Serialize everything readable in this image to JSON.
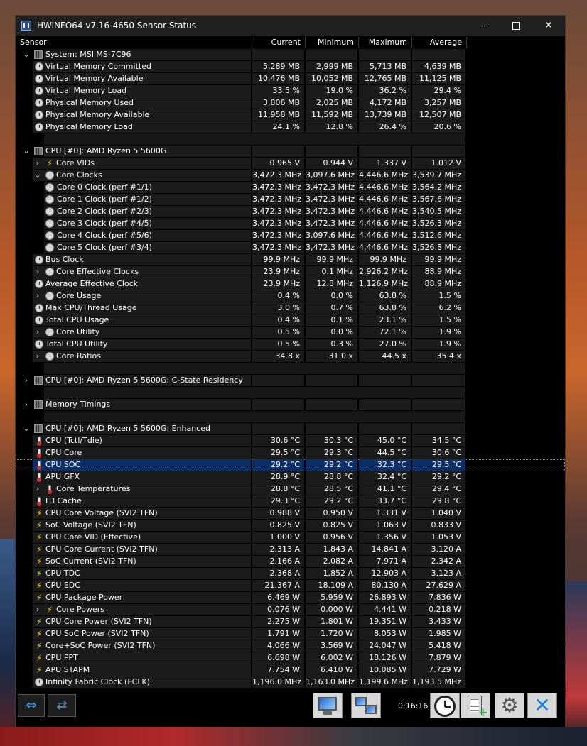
{
  "window": {
    "title": "HWiNFO64 v7.16-4650 Sensor Status"
  },
  "columns": [
    "Sensor",
    "Current",
    "Minimum",
    "Maximum",
    "Average"
  ],
  "rows": [
    {
      "kind": "group",
      "name": "System: MSI MS-7C96",
      "toggle": "v",
      "icon": "chip"
    },
    {
      "kind": "row",
      "name": "Virtual Memory Committed",
      "icon": "clock",
      "level": 0,
      "v": [
        "5,289 MB",
        "2,999 MB",
        "5,713 MB",
        "4,639 MB"
      ]
    },
    {
      "kind": "row",
      "name": "Virtual Memory Available",
      "icon": "clock",
      "level": 0,
      "v": [
        "10,476 MB",
        "10,052 MB",
        "12,765 MB",
        "11,125 MB"
      ]
    },
    {
      "kind": "row",
      "name": "Virtual Memory Load",
      "icon": "clock",
      "level": 0,
      "v": [
        "33.5 %",
        "19.0 %",
        "36.2 %",
        "29.4 %"
      ]
    },
    {
      "kind": "row",
      "name": "Physical Memory Used",
      "icon": "clock",
      "level": 0,
      "v": [
        "3,806 MB",
        "2,025 MB",
        "4,172 MB",
        "3,257 MB"
      ]
    },
    {
      "kind": "row",
      "name": "Physical Memory Available",
      "icon": "clock",
      "level": 0,
      "v": [
        "11,958 MB",
        "11,592 MB",
        "13,739 MB",
        "12,507 MB"
      ]
    },
    {
      "kind": "row",
      "name": "Physical Memory Load",
      "icon": "clock",
      "level": 0,
      "v": [
        "24.1 %",
        "12.8 %",
        "26.4 %",
        "20.6 %"
      ]
    },
    {
      "kind": "blank"
    },
    {
      "kind": "group",
      "name": "CPU [#0]: AMD Ryzen 5 5600G",
      "toggle": "v",
      "icon": "chip"
    },
    {
      "kind": "row",
      "name": "Core VIDs",
      "icon": "bolt",
      "level": 0,
      "toggle": ">",
      "v": [
        "0.965 V",
        "0.944 V",
        "1.337 V",
        "1.012 V"
      ]
    },
    {
      "kind": "row",
      "name": "Core Clocks",
      "icon": "clock",
      "level": 0,
      "toggle": "v",
      "v": [
        "3,472.3 MHz",
        "3,097.6 MHz",
        "4,446.6 MHz",
        "3,539.7 MHz"
      ]
    },
    {
      "kind": "row",
      "name": "Core 0 Clock (perf #1/1)",
      "icon": "clock",
      "level": 1,
      "v": [
        "3,472.3 MHz",
        "3,472.3 MHz",
        "4,446.6 MHz",
        "3,564.2 MHz"
      ]
    },
    {
      "kind": "row",
      "name": "Core 1 Clock (perf #1/2)",
      "icon": "clock",
      "level": 1,
      "v": [
        "3,472.3 MHz",
        "3,472.3 MHz",
        "4,446.6 MHz",
        "3,567.6 MHz"
      ]
    },
    {
      "kind": "row",
      "name": "Core 2 Clock (perf #2/3)",
      "icon": "clock",
      "level": 1,
      "v": [
        "3,472.3 MHz",
        "3,472.3 MHz",
        "4,446.6 MHz",
        "3,540.5 MHz"
      ]
    },
    {
      "kind": "row",
      "name": "Core 3 Clock (perf #4/5)",
      "icon": "clock",
      "level": 1,
      "v": [
        "3,472.3 MHz",
        "3,472.3 MHz",
        "4,446.6 MHz",
        "3,526.3 MHz"
      ]
    },
    {
      "kind": "row",
      "name": "Core 4 Clock (perf #5/6)",
      "icon": "clock",
      "level": 1,
      "v": [
        "3,472.3 MHz",
        "3,097.6 MHz",
        "4,446.6 MHz",
        "3,512.6 MHz"
      ]
    },
    {
      "kind": "row",
      "name": "Core 5 Clock (perf #3/4)",
      "icon": "clock",
      "level": 1,
      "v": [
        "3,472.3 MHz",
        "3,472.3 MHz",
        "4,446.6 MHz",
        "3,526.8 MHz"
      ]
    },
    {
      "kind": "row",
      "name": "Bus Clock",
      "icon": "clock",
      "level": 0,
      "v": [
        "99.9 MHz",
        "99.9 MHz",
        "99.9 MHz",
        "99.9 MHz"
      ]
    },
    {
      "kind": "row",
      "name": "Core Effective Clocks",
      "icon": "clock",
      "level": 0,
      "toggle": ">",
      "v": [
        "23.9 MHz",
        "0.1 MHz",
        "2,926.2 MHz",
        "88.9 MHz"
      ]
    },
    {
      "kind": "row",
      "name": "Average Effective Clock",
      "icon": "clock",
      "level": 0,
      "v": [
        "23.9 MHz",
        "12.8 MHz",
        "1,126.9 MHz",
        "88.9 MHz"
      ]
    },
    {
      "kind": "row",
      "name": "Core Usage",
      "icon": "clock",
      "level": 0,
      "toggle": ">",
      "v": [
        "0.4 %",
        "0.0 %",
        "63.8 %",
        "1.5 %"
      ]
    },
    {
      "kind": "row",
      "name": "Max CPU/Thread Usage",
      "icon": "clock",
      "level": 0,
      "v": [
        "3.0 %",
        "0.7 %",
        "63.8 %",
        "6.2 %"
      ]
    },
    {
      "kind": "row",
      "name": "Total CPU Usage",
      "icon": "clock",
      "level": 0,
      "v": [
        "0.4 %",
        "0.1 %",
        "23.1 %",
        "1.5 %"
      ]
    },
    {
      "kind": "row",
      "name": "Core Utility",
      "icon": "clock",
      "level": 0,
      "toggle": ">",
      "v": [
        "0.5 %",
        "0.0 %",
        "72.1 %",
        "1.9 %"
      ]
    },
    {
      "kind": "row",
      "name": "Total CPU Utility",
      "icon": "clock",
      "level": 0,
      "v": [
        "0.5 %",
        "0.3 %",
        "27.0 %",
        "1.9 %"
      ]
    },
    {
      "kind": "row",
      "name": "Core Ratios",
      "icon": "clock",
      "level": 0,
      "toggle": ">",
      "v": [
        "34.8 x",
        "31.0 x",
        "44.5 x",
        "35.4 x"
      ]
    },
    {
      "kind": "blank"
    },
    {
      "kind": "group",
      "name": "CPU [#0]: AMD Ryzen 5 5600G: C-State Residency",
      "toggle": ">",
      "icon": "chip"
    },
    {
      "kind": "blank"
    },
    {
      "kind": "group",
      "name": "Memory Timings",
      "toggle": ">",
      "icon": "chip"
    },
    {
      "kind": "blank"
    },
    {
      "kind": "group",
      "name": "CPU [#0]: AMD Ryzen 5 5600G: Enhanced",
      "toggle": "v",
      "icon": "chip"
    },
    {
      "kind": "row",
      "name": "CPU (Tctl/Tdie)",
      "icon": "therm",
      "level": 0,
      "v": [
        "30.6 °C",
        "30.3 °C",
        "45.0 °C",
        "34.5 °C"
      ]
    },
    {
      "kind": "row",
      "name": "CPU Core",
      "icon": "therm",
      "level": 0,
      "v": [
        "29.5 °C",
        "29.3 °C",
        "44.5 °C",
        "30.6 °C"
      ]
    },
    {
      "kind": "row",
      "name": "CPU SOC",
      "icon": "therm",
      "level": 0,
      "selected": true,
      "v": [
        "29.2 °C",
        "29.2 °C",
        "32.3 °C",
        "29.5 °C"
      ]
    },
    {
      "kind": "row",
      "name": "APU GFX",
      "icon": "therm",
      "level": 0,
      "v": [
        "28.9 °C",
        "28.8 °C",
        "32.4 °C",
        "29.2 °C"
      ]
    },
    {
      "kind": "row",
      "name": "Core Temperatures",
      "icon": "therm",
      "level": 0,
      "toggle": ">",
      "v": [
        "28.8 °C",
        "28.5 °C",
        "41.1 °C",
        "29.4 °C"
      ]
    },
    {
      "kind": "row",
      "name": "L3 Cache",
      "icon": "therm",
      "level": 0,
      "v": [
        "29.3 °C",
        "29.2 °C",
        "33.7 °C",
        "29.8 °C"
      ]
    },
    {
      "kind": "row",
      "name": "CPU Core Voltage (SVI2 TFN)",
      "icon": "bolt",
      "level": 0,
      "v": [
        "0.988 V",
        "0.950 V",
        "1.331 V",
        "1.040 V"
      ]
    },
    {
      "kind": "row",
      "name": "SoC Voltage (SVI2 TFN)",
      "icon": "bolt",
      "level": 0,
      "v": [
        "0.825 V",
        "0.825 V",
        "1.063 V",
        "0.833 V"
      ]
    },
    {
      "kind": "row",
      "name": "CPU Core VID (Effective)",
      "icon": "bolt",
      "level": 0,
      "v": [
        "1.000 V",
        "0.956 V",
        "1.356 V",
        "1.053 V"
      ]
    },
    {
      "kind": "row",
      "name": "CPU Core Current (SVI2 TFN)",
      "icon": "bolt",
      "level": 0,
      "v": [
        "2.313 A",
        "1.843 A",
        "14.841 A",
        "3.120 A"
      ]
    },
    {
      "kind": "row",
      "name": "SoC Current (SVI2 TFN)",
      "icon": "bolt",
      "level": 0,
      "v": [
        "2.166 A",
        "2.082 A",
        "7.971 A",
        "2.342 A"
      ]
    },
    {
      "kind": "row",
      "name": "CPU TDC",
      "icon": "bolt",
      "level": 0,
      "v": [
        "2.368 A",
        "1.852 A",
        "12.903 A",
        "3.123 A"
      ]
    },
    {
      "kind": "row",
      "name": "CPU EDC",
      "icon": "bolt",
      "level": 0,
      "v": [
        "21.367 A",
        "18.109 A",
        "80.130 A",
        "27.629 A"
      ]
    },
    {
      "kind": "row",
      "name": "CPU Package Power",
      "icon": "bolt",
      "level": 0,
      "v": [
        "6.469 W",
        "5.959 W",
        "26.893 W",
        "7.836 W"
      ]
    },
    {
      "kind": "row",
      "name": "Core Powers",
      "icon": "bolt",
      "level": 0,
      "toggle": ">",
      "v": [
        "0.076 W",
        "0.000 W",
        "4.441 W",
        "0.218 W"
      ]
    },
    {
      "kind": "row",
      "name": "CPU Core Power (SVI2 TFN)",
      "icon": "bolt",
      "level": 0,
      "v": [
        "2.275 W",
        "1.801 W",
        "19.351 W",
        "3.433 W"
      ]
    },
    {
      "kind": "row",
      "name": "CPU SoC Power (SVI2 TFN)",
      "icon": "bolt",
      "level": 0,
      "v": [
        "1.791 W",
        "1.720 W",
        "8.053 W",
        "1.985 W"
      ]
    },
    {
      "kind": "row",
      "name": "Core+SoC Power (SVI2 TFN)",
      "icon": "bolt",
      "level": 0,
      "v": [
        "4.066 W",
        "3.569 W",
        "24.047 W",
        "5.418 W"
      ]
    },
    {
      "kind": "row",
      "name": "CPU PPT",
      "icon": "bolt",
      "level": 0,
      "v": [
        "6.698 W",
        "6.002 W",
        "18.126 W",
        "7.879 W"
      ]
    },
    {
      "kind": "row",
      "name": "APU STAPM",
      "icon": "bolt",
      "level": 0,
      "v": [
        "7.754 W",
        "6.410 W",
        "10.085 W",
        "7.729 W"
      ]
    },
    {
      "kind": "row",
      "name": "Infinity Fabric Clock (FCLK)",
      "icon": "clock",
      "level": 0,
      "v": [
        "1,196.0 MHz",
        "1,163.0 MHz",
        "1,199.6 MHz",
        "1,193.5 MHz"
      ]
    }
  ],
  "toolbar": {
    "timer": "0:16:16"
  }
}
